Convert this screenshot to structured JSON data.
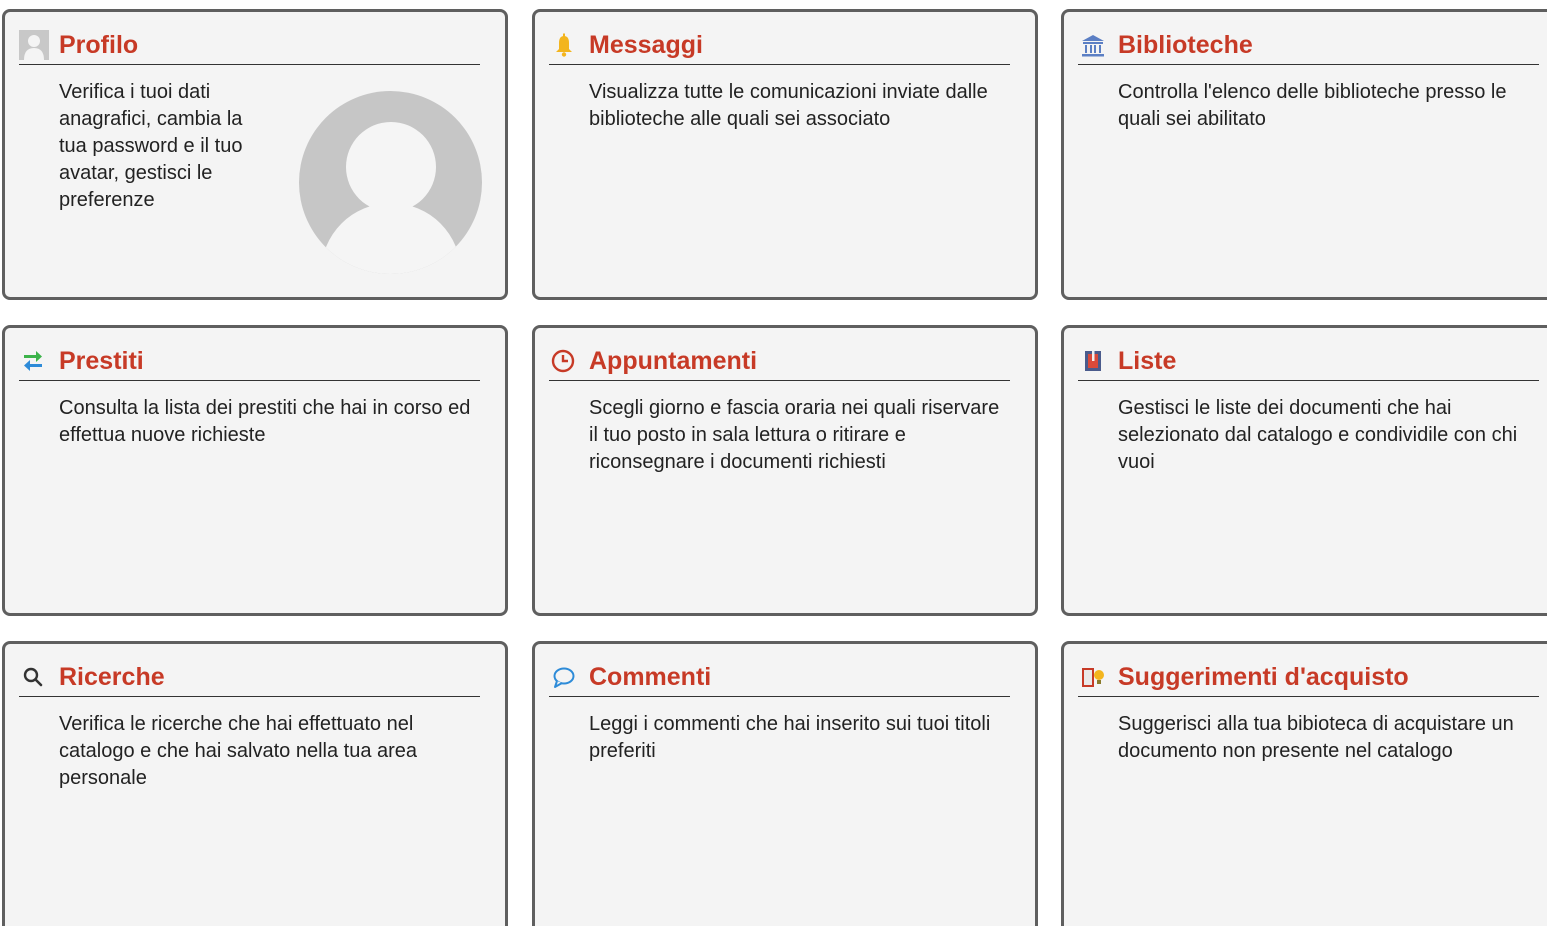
{
  "cards": [
    {
      "title": "Profilo",
      "description": "Verifica i tuoi dati anagrafici, cambia la tua password e il tuo avatar, gestisci le preferenze",
      "icon": "user-icon"
    },
    {
      "title": "Messaggi",
      "description": "Visualizza tutte le comunicazioni inviate dalle biblioteche alle quali sei associato",
      "icon": "bell-icon"
    },
    {
      "title": "Biblioteche",
      "description": "Controlla l'elenco delle biblioteche presso le quali sei abilitato",
      "icon": "library-icon"
    },
    {
      "title": "Prestiti",
      "description": "Consulta la lista dei prestiti che hai in corso ed effettua nuove richieste",
      "icon": "swap-arrows-icon"
    },
    {
      "title": "Appuntamenti",
      "description": "Scegli giorno e fascia oraria nei quali riservare il tuo posto in sala lettura o ritirare e riconsegnare i documenti richiesti",
      "icon": "clock-icon"
    },
    {
      "title": "Liste",
      "description": "Gestisci le liste dei documenti che hai selezionato dal catalogo e condividile con chi vuoi",
      "icon": "list-book-icon"
    },
    {
      "title": "Ricerche",
      "description": "Verifica le ricerche che hai effettuato nel catalogo e che hai salvato nella tua area personale",
      "icon": "search-icon"
    },
    {
      "title": "Commenti",
      "description": "Leggi i commenti che hai inserito sui tuoi titoli preferiti",
      "icon": "comment-icon"
    },
    {
      "title": "Suggerimenti d'acquisto",
      "description": "Suggerisci alla tua bibioteca di acquistare un documento non presente nel catalogo",
      "icon": "book-lightbulb-icon"
    }
  ],
  "colors": {
    "title": "#c73a26",
    "card_background": "#f4f4f4",
    "card_border": "#5f5f5f"
  }
}
